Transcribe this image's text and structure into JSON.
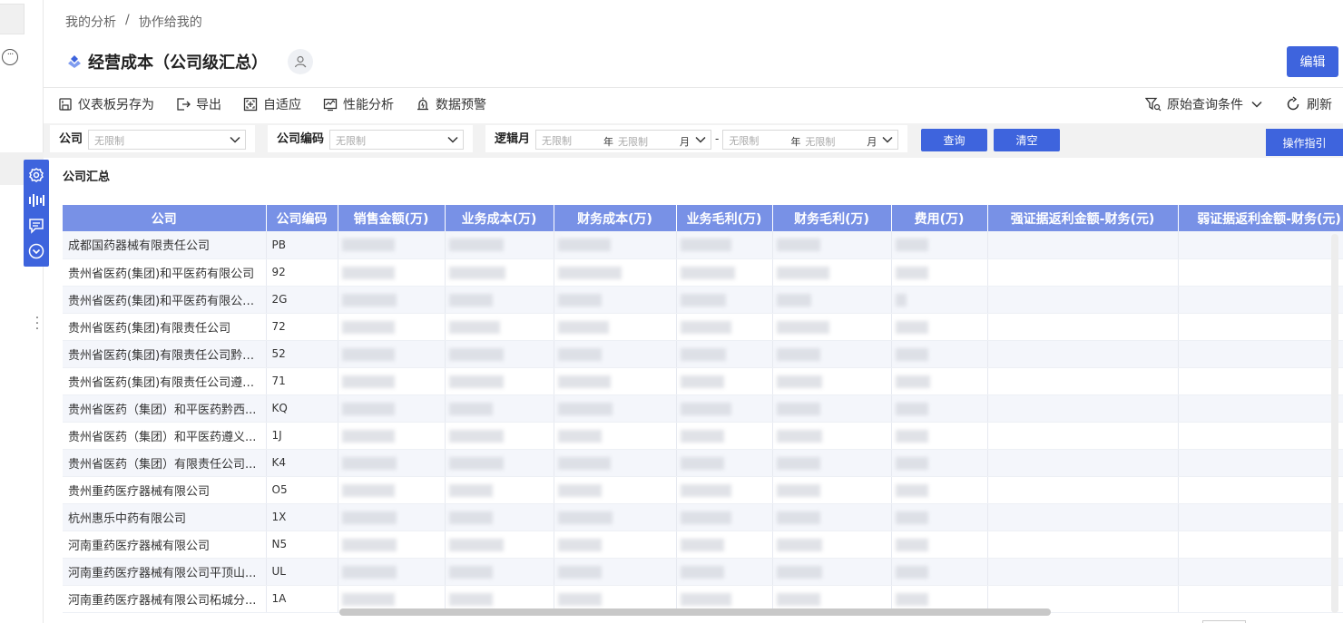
{
  "breadcrumb": [
    "我的分析",
    "协作给我的"
  ],
  "breadcrumb_sep": "/",
  "title": "经营成本（公司级汇总）",
  "edit_label": "编辑",
  "toolbar": {
    "items": [
      {
        "label": "仪表板另存为",
        "icon": "save-copy-icon"
      },
      {
        "label": "导出",
        "icon": "export-icon"
      },
      {
        "label": "自适应",
        "icon": "fit-icon"
      },
      {
        "label": "性能分析",
        "icon": "performance-icon"
      },
      {
        "label": "数据预警",
        "icon": "alarm-icon"
      }
    ],
    "query_conditions": "原始查询条件",
    "refresh": "刷新"
  },
  "filters": {
    "company_label": "公司",
    "company_value": "无限制",
    "code_label": "公司编码",
    "code_value": "无限制",
    "month_label": "逻辑月",
    "from_year": "无限制",
    "from_month": "无限制",
    "to_year": "无限制",
    "to_month": "无限制",
    "year_suffix": "年",
    "month_suffix": "月",
    "range_sep": "-",
    "query_btn": "查询",
    "clear_btn": "清空",
    "guide_btn": "操作指引"
  },
  "section_title": "公司汇总",
  "table": {
    "columns": [
      "公司",
      "公司编码",
      "销售金额(万)",
      "业务成本(万)",
      "财务成本(万)",
      "业务毛利(万)",
      "财务毛利(万)",
      "费用(万)",
      "强证据返利金额-财务(元)",
      "弱证据返利金额-财务(元)"
    ],
    "rows": [
      {
        "company": "成都国药器械有限责任公司",
        "code": "PB"
      },
      {
        "company": "贵州省医药(集团)和平医药有限公司",
        "code": "92"
      },
      {
        "company": "贵州省医药(集团)和平医药有限公司...",
        "code": "2G"
      },
      {
        "company": "贵州省医药(集团)有限责任公司",
        "code": "72"
      },
      {
        "company": "贵州省医药(集团)有限责任公司黔东...",
        "code": "52"
      },
      {
        "company": "贵州省医药(集团)有限责任公司遵义...",
        "code": "71"
      },
      {
        "company": "贵州省医药（集团）和平医药黔西...",
        "code": "KQ"
      },
      {
        "company": "贵州省医药（集团）和平医药遵义...",
        "code": "1J"
      },
      {
        "company": "贵州省医药（集团）有限责任公司...",
        "code": "K4"
      },
      {
        "company": "贵州重药医疗器械有限公司",
        "code": "O5"
      },
      {
        "company": "杭州惠乐中药有限公司",
        "code": "1X"
      },
      {
        "company": "河南重药医疗器械有限公司",
        "code": "N5"
      },
      {
        "company": "河南重药医疗器械有限公司平顶山...",
        "code": "UL"
      },
      {
        "company": "河南重药医疗器械有限公司柘城分...",
        "code": "1A"
      }
    ]
  },
  "colors": {
    "accent": "#3e64dd",
    "header": "#7891e6"
  }
}
